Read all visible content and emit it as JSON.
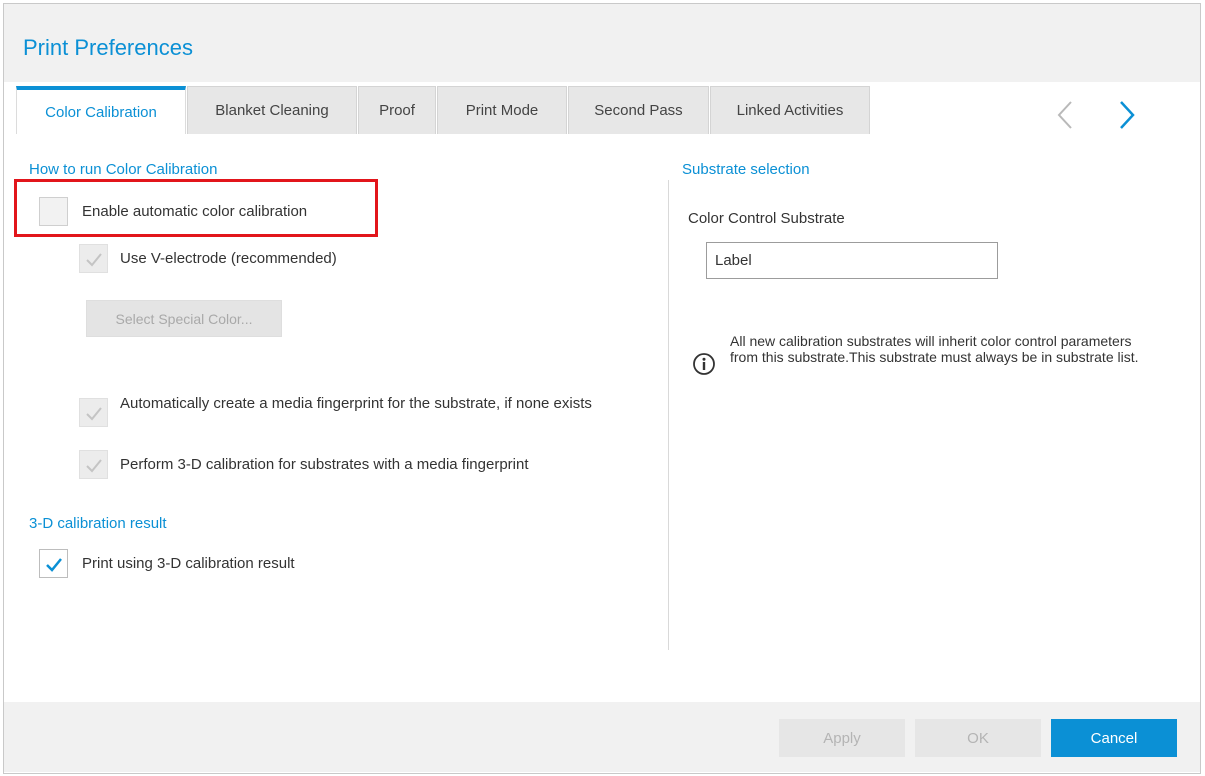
{
  "window": {
    "title": "Print Preferences"
  },
  "tabs": [
    {
      "label": "Color Calibration",
      "active": true
    },
    {
      "label": "Blanket Cleaning",
      "active": false
    },
    {
      "label": "Proof",
      "active": false
    },
    {
      "label": "Print Mode",
      "active": false
    },
    {
      "label": "Second Pass",
      "active": false
    },
    {
      "label": "Linked Activities",
      "active": false
    }
  ],
  "nav": {
    "prev_icon": "chevron-left-icon",
    "next_icon": "chevron-right-icon"
  },
  "color_calibration": {
    "section_title": "How to run Color Calibration",
    "enable_auto": {
      "label": "Enable automatic color calibration",
      "checked": false,
      "enabled": true
    },
    "use_v_electrode": {
      "label": "Use V-electrode (recommended)",
      "checked": true,
      "enabled": false
    },
    "select_special_color_label": "Select Special Color...",
    "auto_fingerprint": {
      "label": "Automatically create a media fingerprint for the substrate, if none exists",
      "checked": true,
      "enabled": false
    },
    "perform_3d": {
      "label": "Perform 3-D calibration for substrates with a media fingerprint",
      "checked": true,
      "enabled": false
    }
  },
  "calibration_result": {
    "section_title": "3-D calibration result",
    "print_using_3d": {
      "label": "Print using 3-D calibration result",
      "checked": true,
      "enabled": true
    }
  },
  "substrate_selection": {
    "section_title": "Substrate selection",
    "field_label": "Color Control Substrate",
    "field_value": "Label",
    "info_icon": "info-icon",
    "info_text": "All new calibration substrates will inherit color control parameters from this substrate.This substrate must always be in substrate list."
  },
  "footer": {
    "apply_label": "Apply",
    "ok_label": "OK",
    "cancel_label": "Cancel"
  },
  "colors": {
    "accent": "#0b90d5",
    "highlight": "#e2151b",
    "header_bg": "#f1f1f1",
    "tab_bg": "#e7e7e7"
  }
}
